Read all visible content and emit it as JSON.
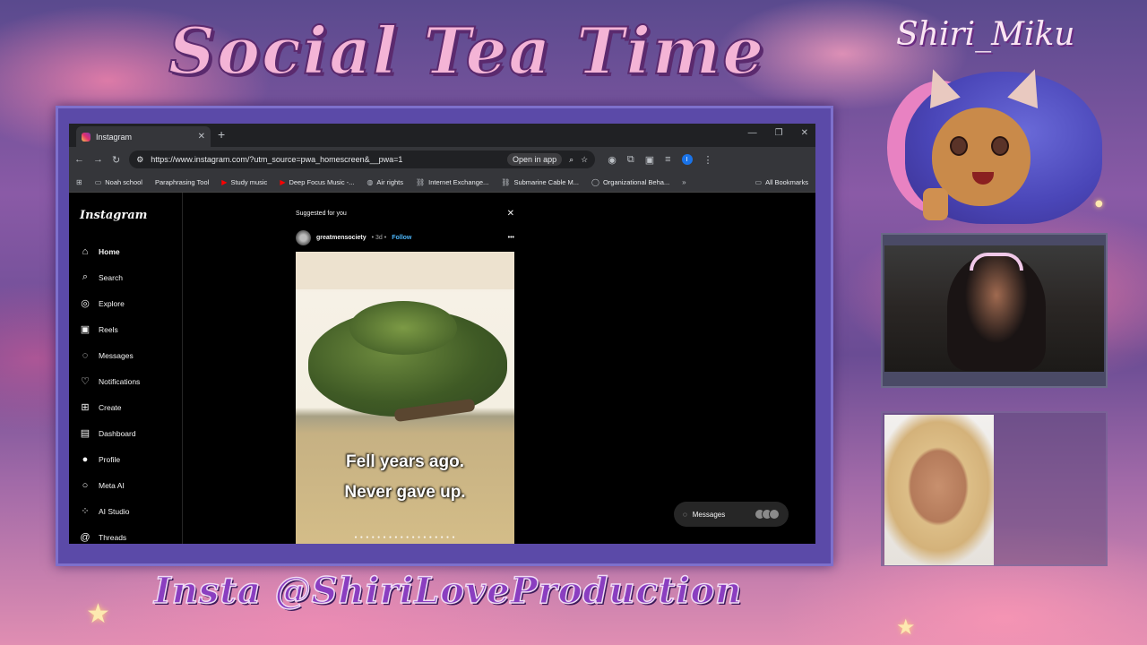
{
  "overlay": {
    "title": "Social Tea Time",
    "handle": "Insta @ShiriLoveProduction",
    "brand": "Shiri_Miku"
  },
  "browser": {
    "tab_title": "Instagram",
    "url": "https://www.instagram.com/?utm_source=pwa_homescreen&__pwa=1",
    "open_in_app": "Open in app",
    "profile_initial": "I",
    "bookmarks": [
      "Noah school",
      "Paraphrasing Tool",
      "Study music",
      "Deep Focus Music -...",
      "Air rights",
      "Internet Exchange...",
      "Submarine Cable M...",
      "Organizational Beha..."
    ],
    "all_bookmarks": "All Bookmarks"
  },
  "instagram": {
    "logo": "Instagram",
    "nav": [
      {
        "label": "Home",
        "icon": "home-icon"
      },
      {
        "label": "Search",
        "icon": "search-icon"
      },
      {
        "label": "Explore",
        "icon": "compass-icon"
      },
      {
        "label": "Reels",
        "icon": "reels-icon"
      },
      {
        "label": "Messages",
        "icon": "messenger-icon"
      },
      {
        "label": "Notifications",
        "icon": "heart-icon"
      },
      {
        "label": "Create",
        "icon": "plus-square-icon"
      },
      {
        "label": "Dashboard",
        "icon": "dashboard-icon"
      },
      {
        "label": "Profile",
        "icon": "profile-avatar-icon"
      },
      {
        "label": "Meta AI",
        "icon": "meta-ai-icon"
      },
      {
        "label": "AI Studio",
        "icon": "ai-studio-icon"
      },
      {
        "label": "Threads",
        "icon": "threads-icon"
      }
    ],
    "suggested_label": "Suggested for you",
    "post": {
      "username": "greatmensociety",
      "age": "• 3d •",
      "follow": "Follow",
      "caption_line1": "Fell years ago.",
      "caption_line2": "Never gave up."
    },
    "messages_label": "Messages"
  }
}
